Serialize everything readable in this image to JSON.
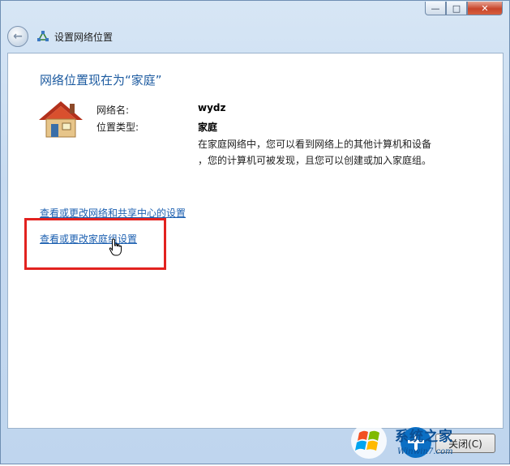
{
  "window": {
    "controls": {
      "minimize": "—",
      "maximize": "□",
      "close": "✕"
    }
  },
  "nav": {
    "back_icon": "back-arrow-icon",
    "title": "设置网络位置"
  },
  "content": {
    "heading": "网络位置现在为“家庭”",
    "network_name_label": "网络名:",
    "network_name_value": "wydz",
    "location_type_label": "位置类型:",
    "location_type_value": "家庭",
    "description_line1": "在家庭网络中，您可以看到网络上的其他计算机和设备",
    "description_line2": "，您的计算机可被发现，且您可以创建或加入家庭组。",
    "link_sharing_center": "查看或更改网络和共享中心的设置",
    "link_homegroup": "查看或更改家庭组设置"
  },
  "footer": {
    "close_button": "关闭(C)"
  },
  "watermark": {
    "text": "系统之家",
    "url": "Winwin7.com"
  },
  "colors": {
    "heading": "#1d5ba0",
    "link": "#1b5fb0",
    "highlight": "#e2221f"
  }
}
